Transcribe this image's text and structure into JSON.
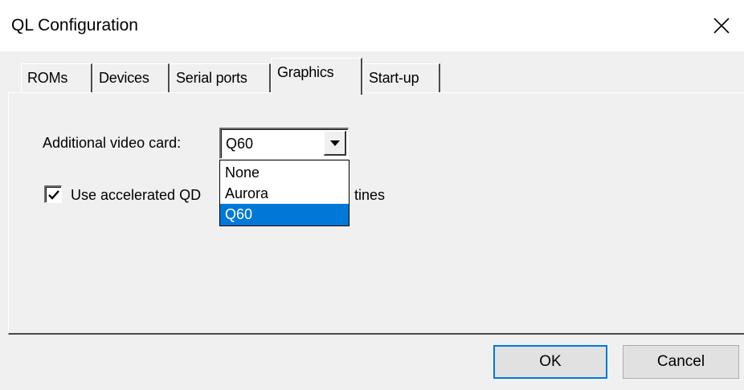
{
  "window": {
    "title": "QL Configuration",
    "close_icon": "close-icon"
  },
  "tabs": [
    {
      "label": "ROMs",
      "active": false
    },
    {
      "label": "Devices",
      "active": false
    },
    {
      "label": "Serial ports",
      "active": false
    },
    {
      "label": "Graphics",
      "active": true
    },
    {
      "label": "Start-up",
      "active": false
    }
  ],
  "graphics": {
    "video_card_label": "Additional video card:",
    "video_card_value": "Q60",
    "video_card_options": [
      "None",
      "Aurora",
      "Q60"
    ],
    "video_card_selected_option": "Q60",
    "accelerated_checkbox": {
      "checked": true,
      "label_visible_start": "Use accelerated QD",
      "label_visible_end": "tines"
    }
  },
  "buttons": {
    "ok": "OK",
    "cancel": "Cancel"
  },
  "colors": {
    "selection": "#0078d7",
    "default_button_border": "#0078d7"
  }
}
